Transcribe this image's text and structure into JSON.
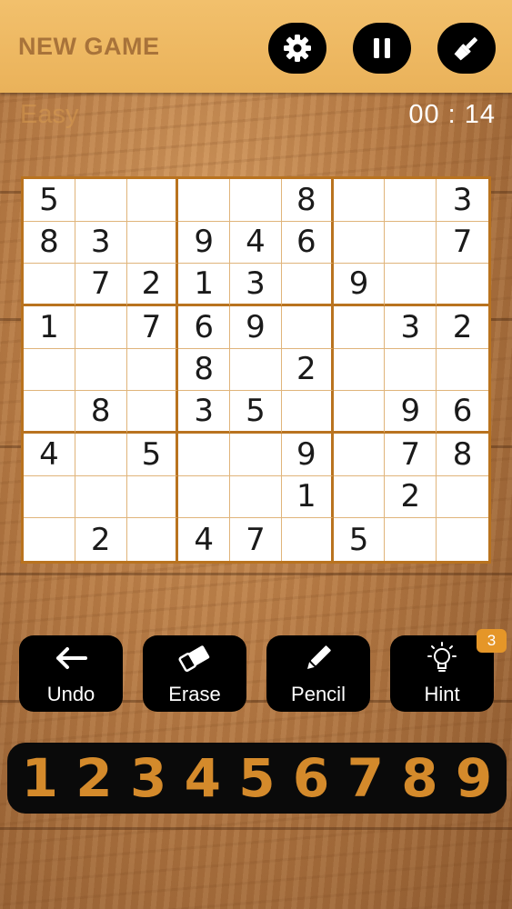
{
  "header": {
    "new_game_label": "NEW GAME"
  },
  "colors": {
    "accent": "#d48a2b",
    "header_bg": "#eab25a",
    "board_line": "#b9731f"
  },
  "status": {
    "difficulty": "Easy",
    "timer": "00 : 14"
  },
  "board": {
    "rows": [
      [
        "5",
        "",
        "",
        "",
        "",
        "8",
        "",
        "",
        "3"
      ],
      [
        "8",
        "3",
        "",
        "9",
        "4",
        "6",
        "",
        "",
        "7"
      ],
      [
        "",
        "7",
        "2",
        "1",
        "3",
        "",
        "9",
        "",
        ""
      ],
      [
        "1",
        "",
        "7",
        "6",
        "9",
        "",
        "",
        "3",
        "2"
      ],
      [
        "",
        "",
        "",
        "8",
        "",
        "2",
        "",
        "",
        ""
      ],
      [
        "",
        "8",
        "",
        "3",
        "5",
        "",
        "",
        "9",
        "6"
      ],
      [
        "4",
        "",
        "5",
        "",
        "",
        "9",
        "",
        "7",
        "8"
      ],
      [
        "",
        "",
        "",
        "",
        "",
        "1",
        "",
        "2",
        ""
      ],
      [
        "",
        "2",
        "",
        "4",
        "7",
        "",
        "5",
        "",
        ""
      ]
    ]
  },
  "tools": {
    "undo": "Undo",
    "erase": "Erase",
    "pencil": "Pencil",
    "hint": "Hint",
    "hint_count": "3"
  },
  "numpad": [
    "1",
    "2",
    "3",
    "4",
    "5",
    "6",
    "7",
    "8",
    "9"
  ]
}
